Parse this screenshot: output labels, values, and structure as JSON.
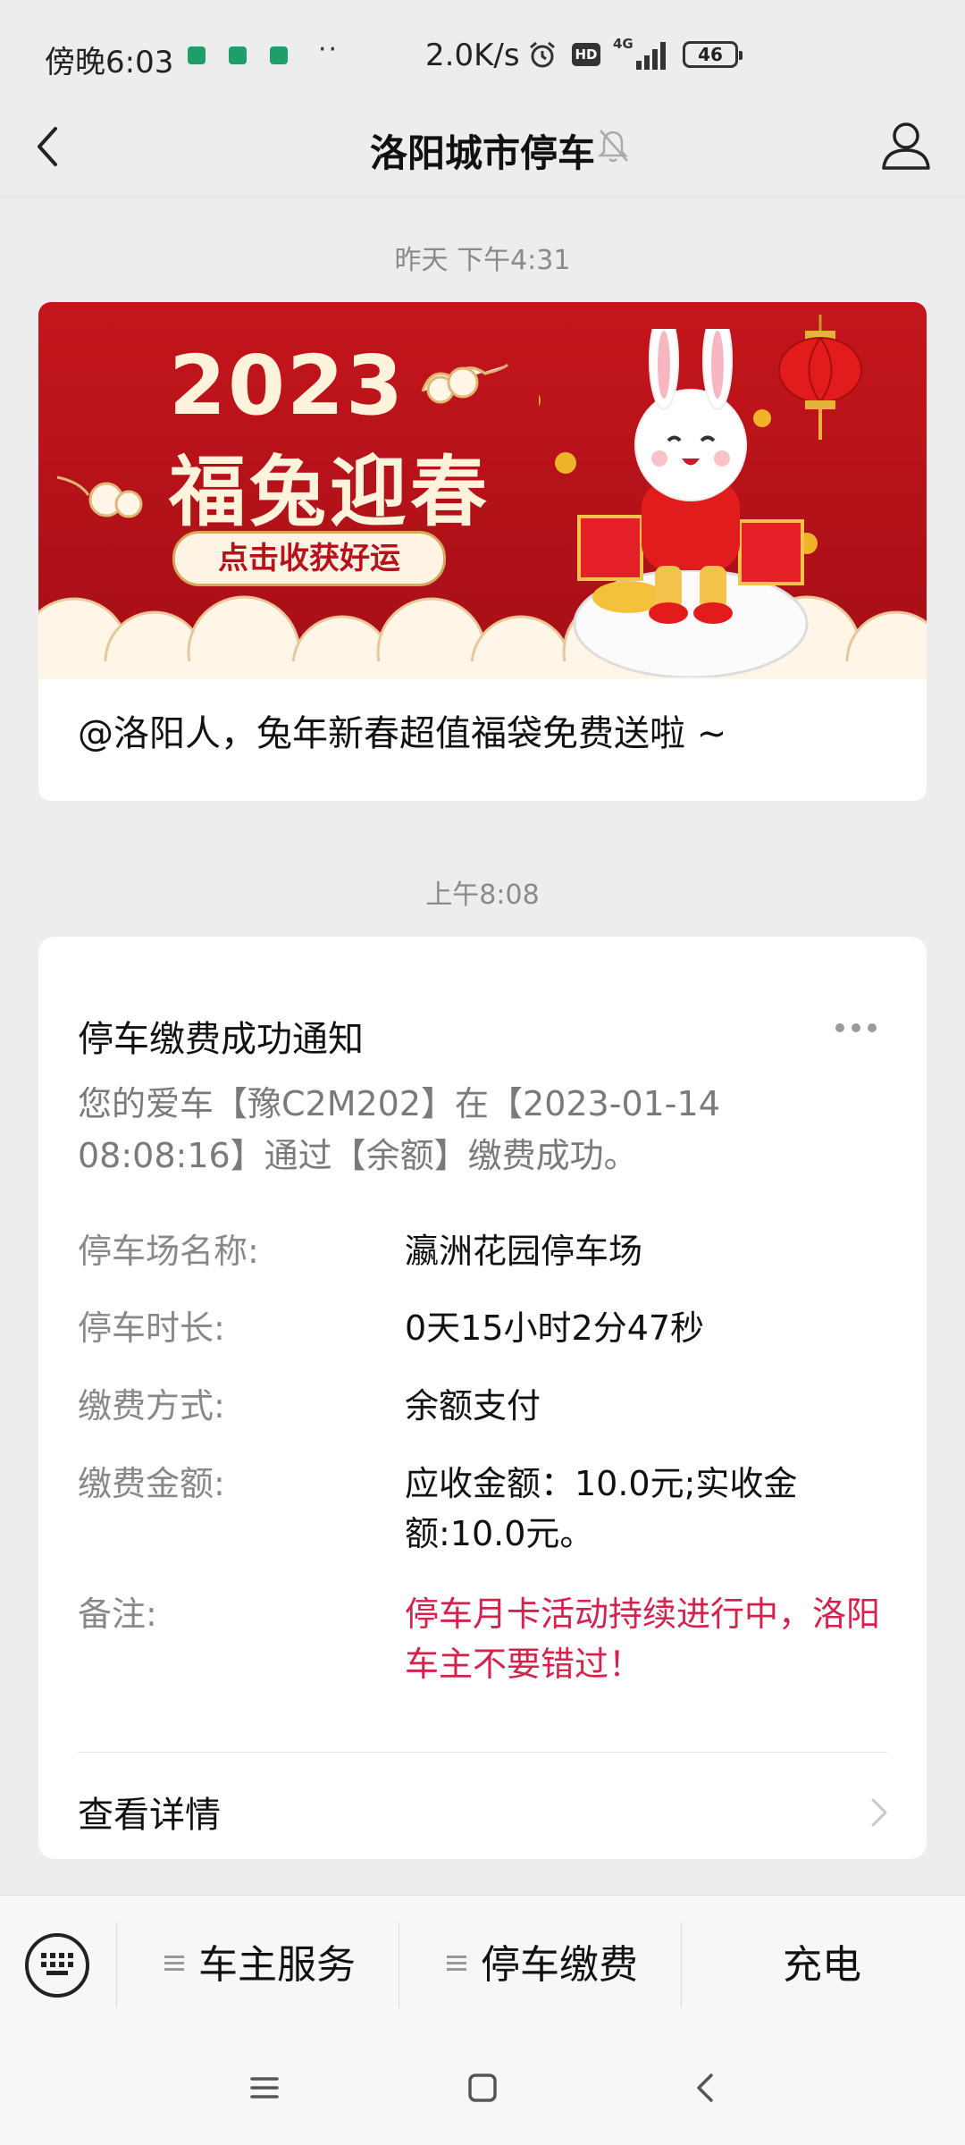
{
  "status_bar": {
    "time": "傍晚6:03",
    "dots": "··",
    "speed": "2.0K/s",
    "hd": "HD",
    "network": "4G",
    "battery": "46"
  },
  "nav": {
    "title": "洛阳城市停车"
  },
  "messages": [
    {
      "timestamp": "昨天 下午4:31"
    },
    {
      "timestamp": "上午8:08"
    }
  ],
  "promo": {
    "banner_year": "2023",
    "banner_slogan": "福兔迎春",
    "banner_button": "点击收获好运",
    "caption": "@洛阳人，兔年新春超值福袋免费送啦 ~"
  },
  "notice": {
    "title": "停车缴费成功通知",
    "description": "您的爱车【豫C2M202】在【2023-01-14 08:08:16】通过【余额】缴费成功。",
    "rows": [
      {
        "label": "停车场名称:",
        "value": "瀛洲花园停车场"
      },
      {
        "label": "停车时长:",
        "value": "0天15小时2分47秒"
      },
      {
        "label": "缴费方式:",
        "value": "余额支付"
      },
      {
        "label": "缴费金额:",
        "value": "应收金额：10.0元;实收金额:10.0元。"
      },
      {
        "label": "备注:",
        "value": "停车月卡活动持续进行中，洛阳车主不要错过！"
      }
    ],
    "detail_link": "查看详情",
    "remark_color": "#d3234d"
  },
  "menu": {
    "items": [
      "车主服务",
      "停车缴费",
      "充电"
    ]
  },
  "colors": {
    "banner_red": "#c4151c",
    "page_bg": "#ededed"
  },
  "icons": [
    "back-arrow-icon",
    "mute-bell-icon",
    "profile-icon",
    "more-dots-icon",
    "chevron-right-icon",
    "keyboard-icon",
    "menu-lines-icon",
    "home-square-icon",
    "back-triangle-icon"
  ]
}
